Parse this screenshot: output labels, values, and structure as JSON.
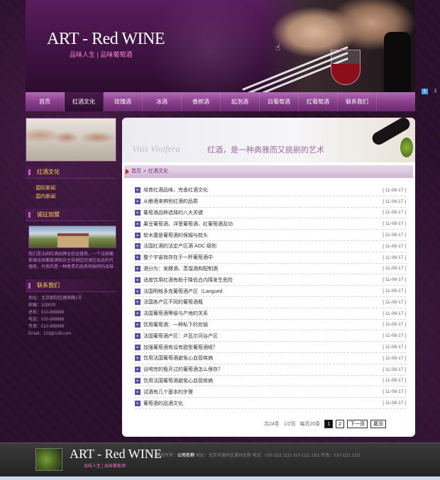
{
  "header": {
    "logo_title": "ART - Red WINE",
    "logo_subtitle": "品味人生 | 品味葡萄酒",
    "slider_pages": [
      "1",
      "2"
    ]
  },
  "nav": {
    "items": [
      "首页",
      "红酒文化",
      "玫瑰酒",
      "冰酒",
      "香槟酒",
      "起泡酒",
      "白葡萄酒",
      "红葡萄酒",
      "联系我们"
    ],
    "active_index": 1
  },
  "sidebar": {
    "culture_heading": "红酒文化",
    "culture_links": [
      "国际新闻",
      "国内新闻"
    ],
    "join_heading": "诚征加盟",
    "join_intro": "我们是法国红酒品牌全权运营商，一个法国葡萄酒法国葡萄酒商杂主导地区的酒庄出品的代理商，代表的是一种尊贵的品质和独特的品味",
    "contact_heading": "联系我们",
    "contact_lines": [
      "地址：北京朝阳区建国路1号",
      "邮编：100000",
      "总机：010-888888",
      "电话：010-888888",
      "传真：010-999999",
      "Email：123@126.com"
    ]
  },
  "banner": {
    "en_text": "Vitis Vinifera",
    "cn_text": "红酒，是一种典雅而又挑剔的艺术"
  },
  "breadcrumb": {
    "home": "首页",
    "separator": "»",
    "current": "红酒文化"
  },
  "articles": [
    {
      "title": "培育红酒品味，完善红酒文化",
      "date": "[ 11-08-17 ]"
    },
    {
      "title": "从酿酒来辨别红酒的品质",
      "date": "[ 11-08-17 ]"
    },
    {
      "title": "葡萄酒品种选择的八大关键",
      "date": "[ 11-08-17 ]"
    },
    {
      "title": "果豆葡萄酒、洋葱葡萄酒、红葡萄酒及功",
      "date": "[ 11-08-17 ]"
    },
    {
      "title": "软木塞是葡萄酒的保姆与枕头",
      "date": "[ 11-08-17 ]"
    },
    {
      "title": "法国红酒的法定产区酒 AOC 级别",
      "date": "[ 11-08-17 ]"
    },
    {
      "title": "整个宇宙就存在于一杯葡萄酒中",
      "date": "[ 11-08-17 ]"
    },
    {
      "title": "酒分为：发酵酒、蒸馏酒和配制酒",
      "date": "[ 11-08-17 ]"
    },
    {
      "title": "适度饮用红酒有助于降低白内障发生危险",
      "date": "[ 11-08-17 ]"
    },
    {
      "title": "法国明格多克葡萄酒产区（Langued",
      "date": "[ 11-08-17 ]"
    },
    {
      "title": "法国各产区不同的葡萄酒瓶",
      "date": "[ 11-08-17 ]"
    },
    {
      "title": "法国葡萄酒等级与产地的关系",
      "date": "[ 11-08-17 ]"
    },
    {
      "title": "饮用葡萄酒：一种私下的欢愉",
      "date": "[ 11-08-17 ]"
    },
    {
      "title": "法国葡萄酒产区：卢瓦尔河谷产区",
      "date": "[ 11-08-17 ]"
    },
    {
      "title": "加强葡萄酒有设有甜型葡萄酒呢？",
      "date": "[ 11-08-17 ]"
    },
    {
      "title": "饮用法国葡萄酒避免心血管疾病",
      "date": "[ 11-08-17 ]"
    },
    {
      "title": "设喝完的瓶开过的葡萄酒怎么保存？",
      "date": "[ 11-08-17 ]"
    },
    {
      "title": "饮用法国葡萄酒避免心血管疾病",
      "date": "[ 11-08-17 ]"
    },
    {
      "title": "试酒有几个基本的步骤",
      "date": "[ 11-08-17 ]"
    },
    {
      "title": "葡萄酒的品酒文化",
      "date": "[ 11-08-17 ]"
    }
  ],
  "pager": {
    "total": "共24条",
    "page_of": "1/2页",
    "per_page": "每页20条",
    "pages": [
      "1",
      "2"
    ],
    "current_page": "1",
    "next": "下一页",
    "last": "尾页"
  },
  "footer": {
    "title": "ART - Red WINE",
    "subtitle": "品味人生 | 品味葡萄酒",
    "copyright_label": "版权所有：",
    "company": "公司名称",
    "info": "地址：北京市通州区通州北苑  电话：010-1111 1111  010-1111 1111  传真：010-1111 1111"
  }
}
